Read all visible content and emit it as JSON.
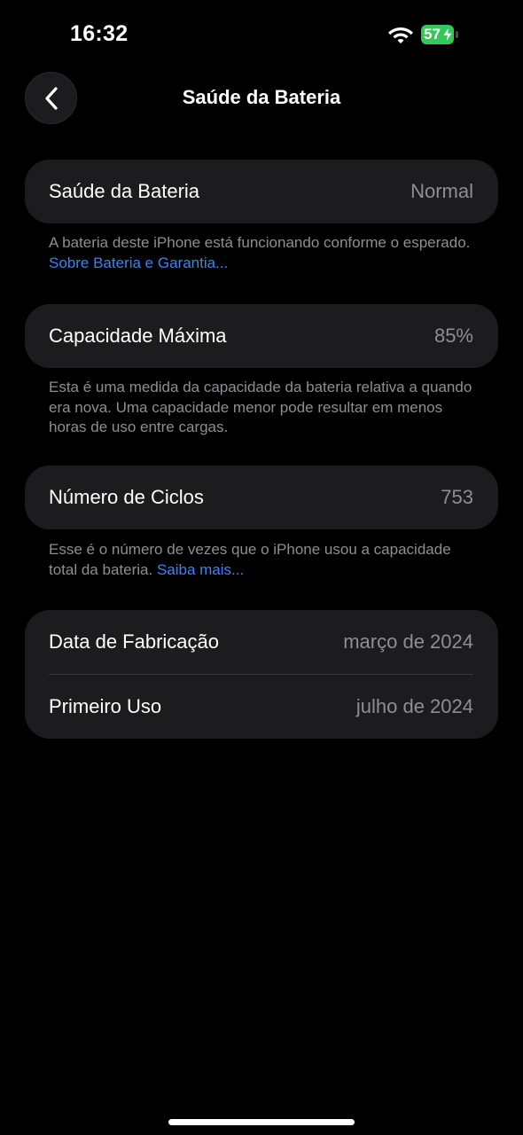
{
  "status_bar": {
    "time": "16:32",
    "battery_percent": "57",
    "battery_color": "#34c759"
  },
  "nav": {
    "back_icon": "chevron-left-icon",
    "title": "Saúde da Bateria"
  },
  "sections": {
    "health": {
      "label": "Saúde da Bateria",
      "value": "Normal",
      "footnote": "A bateria deste iPhone está funcionando conforme o esperado.",
      "link": "Sobre Bateria e Garantia..."
    },
    "capacity": {
      "label": "Capacidade Máxima",
      "value": "85%",
      "footnote": "Esta é uma medida da capacidade da bateria relativa a quando era nova. Uma capacidade menor pode resultar em menos horas de uso entre cargas."
    },
    "cycles": {
      "label": "Número de Ciclos",
      "value": "753",
      "footnote": "Esse é o número de vezes que o iPhone usou a capacidade total da bateria.",
      "link": "Saiba mais..."
    },
    "dates": {
      "manufacture_label": "Data de Fabricação",
      "manufacture_value": "março de 2024",
      "first_use_label": "Primeiro Uso",
      "first_use_value": "julho de 2024"
    }
  },
  "colors": {
    "link": "#3b82f6",
    "card": "#1c1c1e",
    "secondary_text": "#8e8e93"
  }
}
